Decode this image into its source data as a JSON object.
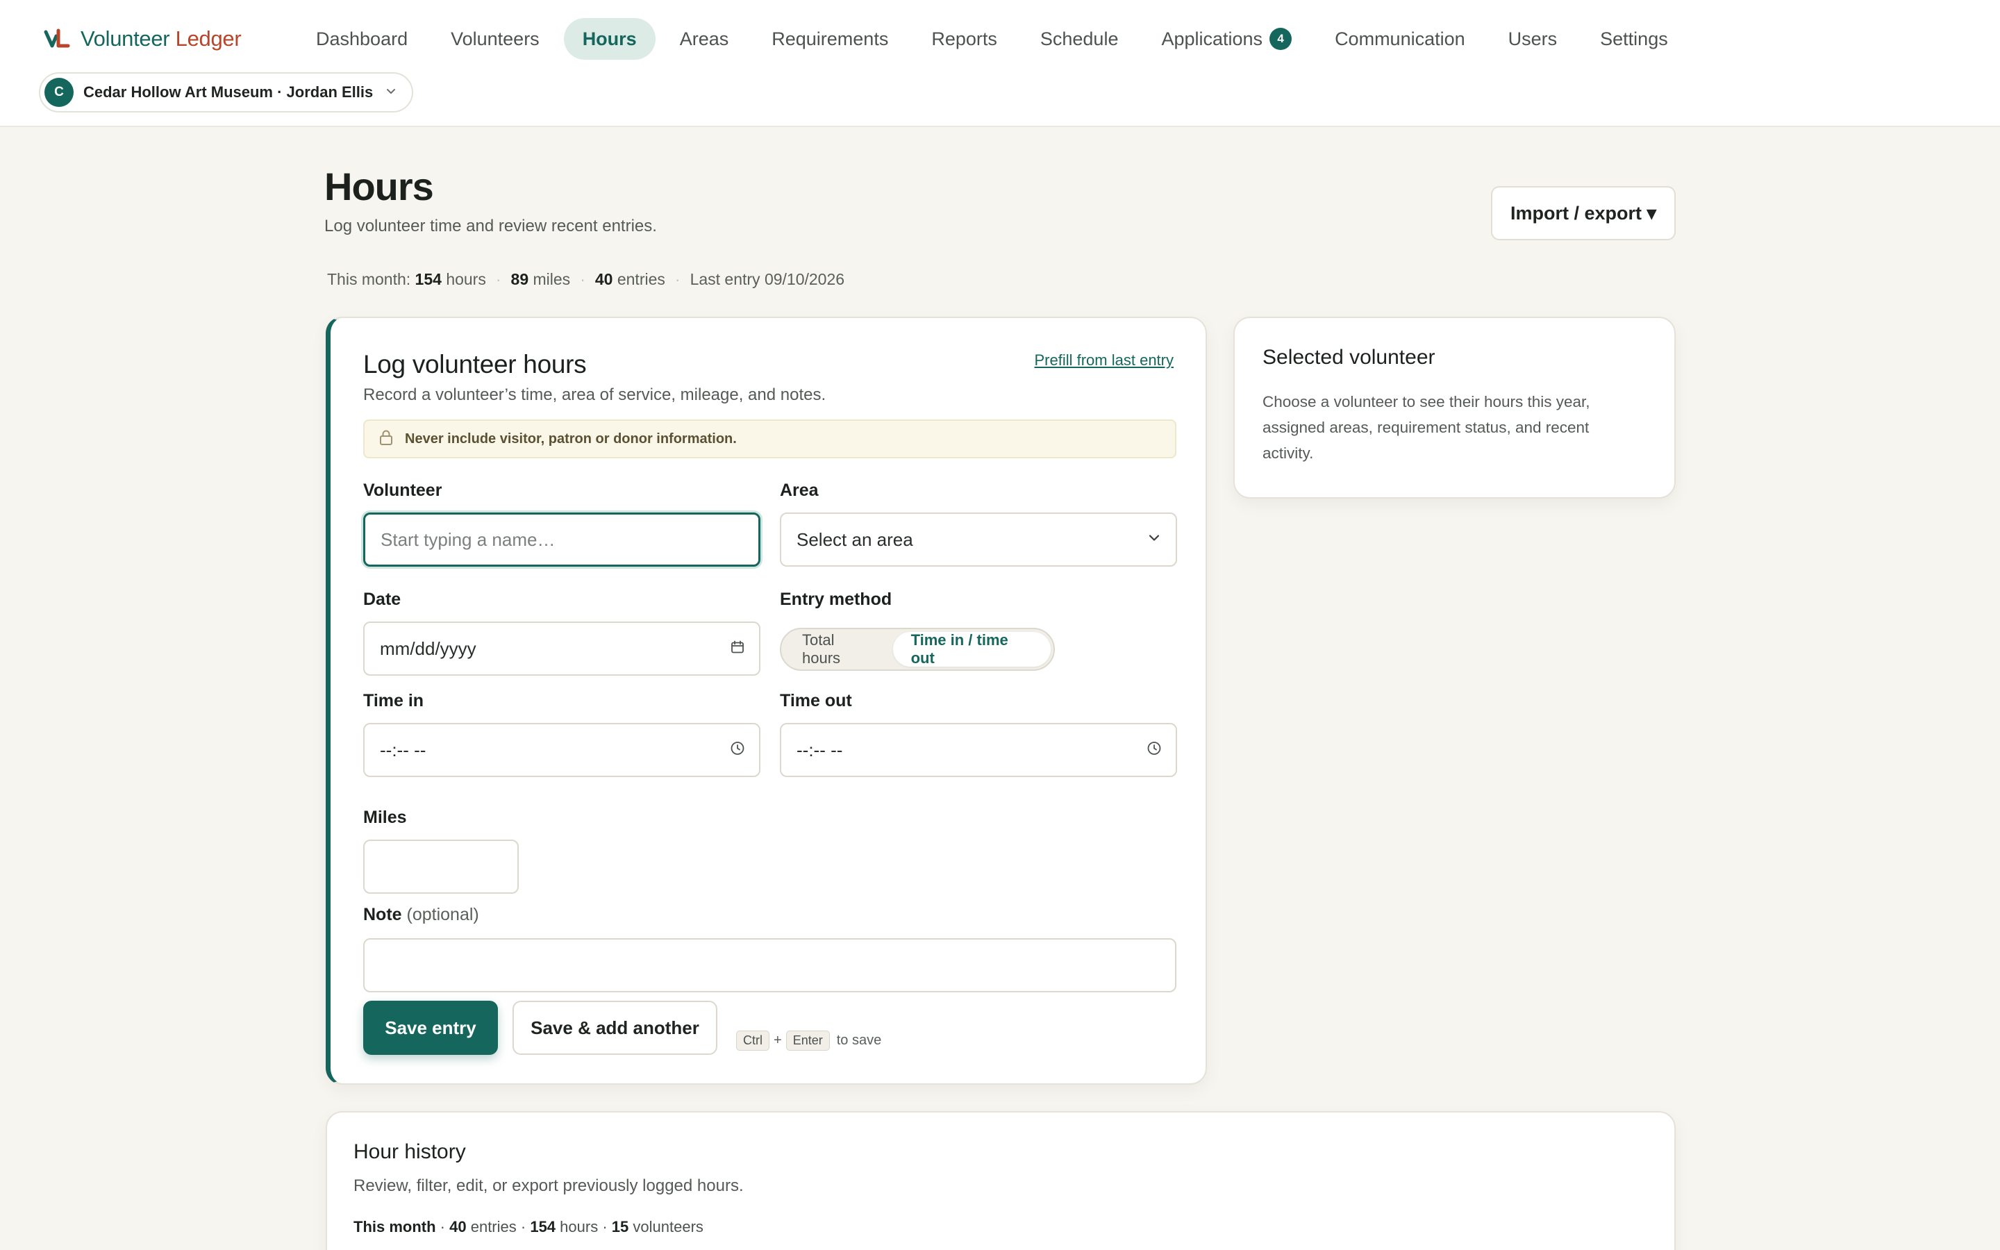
{
  "brand": {
    "name_part1": "Volunteer",
    "name_part2": "Ledger"
  },
  "nav": {
    "items": [
      {
        "label": "Dashboard"
      },
      {
        "label": "Volunteers"
      },
      {
        "label": "Hours",
        "active": true
      },
      {
        "label": "Areas"
      },
      {
        "label": "Requirements"
      },
      {
        "label": "Reports"
      },
      {
        "label": "Schedule"
      },
      {
        "label": "Applications",
        "badge": "4"
      },
      {
        "label": "Communication"
      },
      {
        "label": "Users"
      },
      {
        "label": "Settings"
      }
    ]
  },
  "org": {
    "avatar_letter": "C",
    "label": "Cedar Hollow Art Museum · Jordan Ellis"
  },
  "header": {
    "title": "Hours",
    "subtitle": "Log volunteer time and review recent entries.",
    "import_label": "Import / export ▾"
  },
  "stats": {
    "prefix": "This month:",
    "hours": "154",
    "hours_unit": "hours",
    "miles": "89",
    "miles_unit": "miles",
    "entries": "40",
    "entries_unit": "entries",
    "last_entry": "Last entry 09/10/2026"
  },
  "log_form": {
    "title": "Log volunteer hours",
    "subtitle": "Record a volunteer’s time, area of service, mileage, and notes.",
    "prefill_label": "Prefill from last entry",
    "warning": "Never include visitor, patron or donor information.",
    "volunteer_label": "Volunteer",
    "volunteer_placeholder": "Start typing a name…",
    "area_label": "Area",
    "area_value": "Select an area",
    "date_label": "Date",
    "date_placeholder": "mm/dd/yyyy",
    "entry_method_label": "Entry method",
    "entry_method_options": [
      "Total hours",
      "Time in / time out"
    ],
    "entry_method_selected": "Time in / time out",
    "time_in_label": "Time in",
    "time_in_placeholder": "--:-- --",
    "time_out_label": "Time out",
    "time_out_placeholder": "--:-- --",
    "miles_label": "Miles",
    "miles_value": "",
    "note_label": "Note",
    "note_optional": "(optional)",
    "note_value": "",
    "save_label": "Save entry",
    "save_add_label": "Save & add another",
    "kbd_ctrl": "Ctrl",
    "kbd_plus": "+",
    "kbd_enter": "Enter",
    "kbd_suffix": "to save"
  },
  "selected_volunteer": {
    "title": "Selected volunteer",
    "body": "Choose a volunteer to see their hours this year, assigned areas, requirement status, and recent activity."
  },
  "history": {
    "title": "Hour history",
    "subtitle": "Review, filter, edit, or export previously logged hours.",
    "period": "This month",
    "entries": "40",
    "entries_unit": "entries",
    "hours": "154",
    "hours_unit": "hours",
    "volunteers": "15",
    "volunteers_unit": "volunteers"
  },
  "colors": {
    "accent": "#15675d",
    "brand_secondary": "#b8452a",
    "background": "#f7f5ef"
  }
}
